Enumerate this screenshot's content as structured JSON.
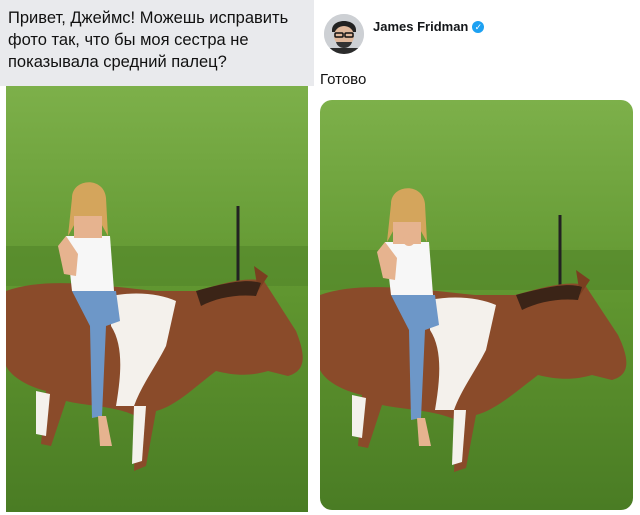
{
  "request": {
    "text": "Привет, Джеймс! Можешь исправить фото так, что бы моя сестра не показывала средний палец?"
  },
  "reply": {
    "author_name": "James Fridman",
    "verified_icon": "verified-badge-icon",
    "text": "Готово"
  },
  "colors": {
    "request_bg": "#e9eaed",
    "verified": "#1da1f2",
    "grass": "#5f8f2e",
    "horse_brown": "#8a4b2a"
  }
}
